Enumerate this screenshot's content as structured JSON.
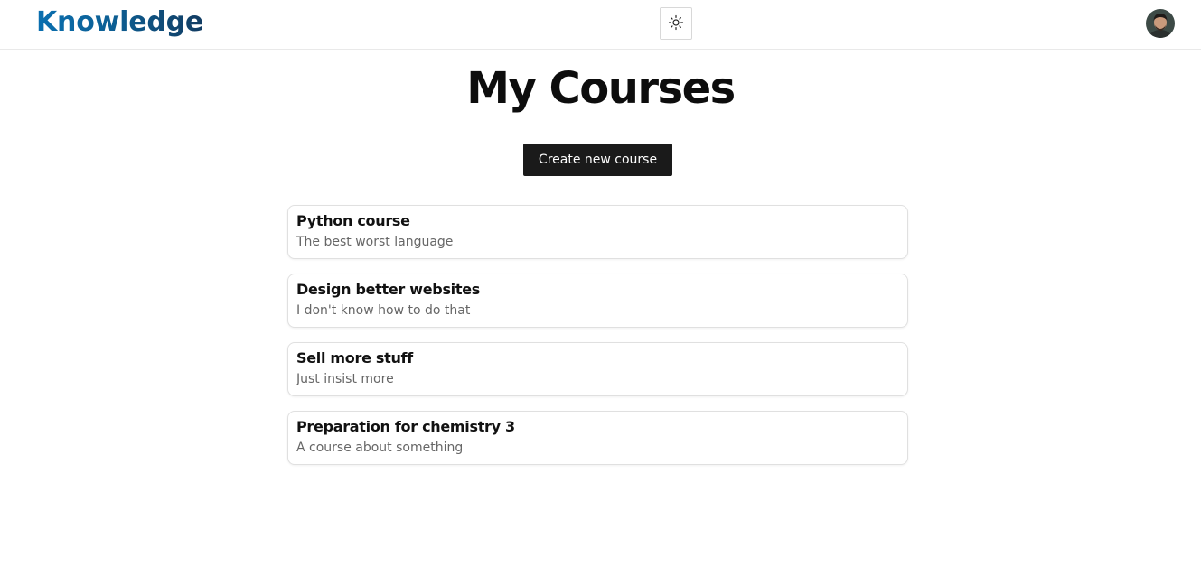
{
  "header": {
    "logo_text": "Knowledge",
    "theme_toggle_icon": "sun-icon",
    "avatar_icon": "avatar"
  },
  "main": {
    "title": "My Courses",
    "create_button_label": "Create new course",
    "courses": [
      {
        "title": "Python course",
        "description": "The best worst language"
      },
      {
        "title": "Design better websites",
        "description": "I don't know how to do that"
      },
      {
        "title": "Sell more stuff",
        "description": "Just insist more"
      },
      {
        "title": "Preparation for chemistry 3",
        "description": "A course about something"
      }
    ]
  },
  "colors": {
    "logo_gradient_start": "#0a6fb0",
    "logo_gradient_end": "#123c62",
    "button_background": "#1a1a1a",
    "card_border": "#e0e0e0",
    "description_text": "#666666"
  }
}
